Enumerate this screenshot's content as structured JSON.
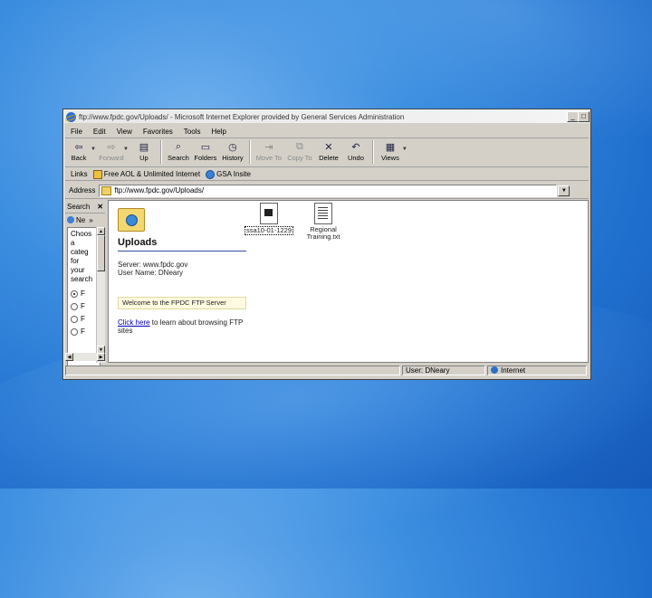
{
  "window": {
    "title": "ftp://www.fpdc.gov/Uploads/ - Microsoft Internet Explorer provided by General Services Administration"
  },
  "menu": [
    "File",
    "Edit",
    "View",
    "Favorites",
    "Tools",
    "Help"
  ],
  "toolbar": [
    {
      "label": "Back",
      "icon": "back-arrow-icon"
    },
    {
      "label": "Forward",
      "icon": "forward-arrow-icon"
    },
    {
      "label": "Up",
      "icon": "up-folder-icon"
    },
    {
      "label": "Search",
      "icon": "search-icon"
    },
    {
      "label": "Folders",
      "icon": "folders-icon"
    },
    {
      "label": "History",
      "icon": "history-icon"
    },
    {
      "label": "Move To",
      "icon": "move-to-icon"
    },
    {
      "label": "Copy To",
      "icon": "copy-to-icon"
    },
    {
      "label": "Delete",
      "icon": "delete-icon"
    },
    {
      "label": "Undo",
      "icon": "undo-icon"
    },
    {
      "label": "Views",
      "icon": "views-icon"
    }
  ],
  "links": {
    "label": "Links",
    "items": [
      "Free AOL & Unlimited Internet",
      "GSA Insite"
    ]
  },
  "address": {
    "label": "Address",
    "value": "ftp://www.fpdc.gov/Uploads/"
  },
  "search_pane": {
    "title": "Search",
    "new_label": "Ne",
    "body_text": [
      "Choos",
      "a",
      "categ",
      "for",
      "your",
      "search"
    ],
    "radio_labels": [
      "F",
      "F",
      "F",
      "F"
    ]
  },
  "content": {
    "heading": "Uploads",
    "server_line": "Server: www.fpdc.gov",
    "user_line": "User Name: DNeary",
    "welcome": "Welcome to the FPDC FTP Server",
    "click_link": "Click here",
    "click_rest": " to learn about browsing FTP sites",
    "files": [
      {
        "name": "ssa10-01-1229",
        "selected": true
      },
      {
        "name": "Regional Training.txt",
        "selected": false
      }
    ]
  },
  "status": {
    "user": "User: DNeary",
    "zone": "Internet"
  }
}
